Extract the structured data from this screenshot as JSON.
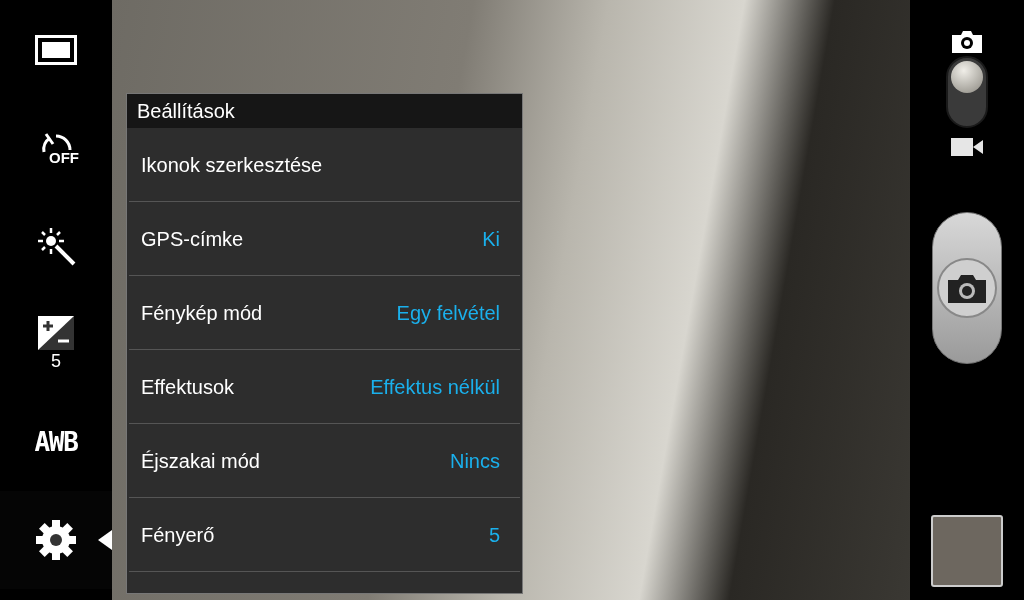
{
  "sidebar": {
    "items": [
      {
        "kind": "aspect",
        "selected": false
      },
      {
        "kind": "timer",
        "label": "OFF",
        "selected": false
      },
      {
        "kind": "effect",
        "selected": false
      },
      {
        "kind": "exposure",
        "label": "5",
        "selected": false
      },
      {
        "kind": "white_balance",
        "label": "AWB",
        "selected": false
      },
      {
        "kind": "settings",
        "selected": true
      }
    ]
  },
  "settings_menu": {
    "title": "Beállítások",
    "items": [
      {
        "label": "Ikonok szerkesztése"
      },
      {
        "label": "GPS-címke",
        "value": "Ki"
      },
      {
        "label": "Fénykép mód",
        "value": "Egy felvétel"
      },
      {
        "label": "Effektusok",
        "value": "Effektus nélkül"
      },
      {
        "label": "Éjszakai mód",
        "value": "Nincs"
      },
      {
        "label": "Fényerő",
        "value": "5"
      }
    ]
  },
  "mode_switch": {
    "video": false
  }
}
